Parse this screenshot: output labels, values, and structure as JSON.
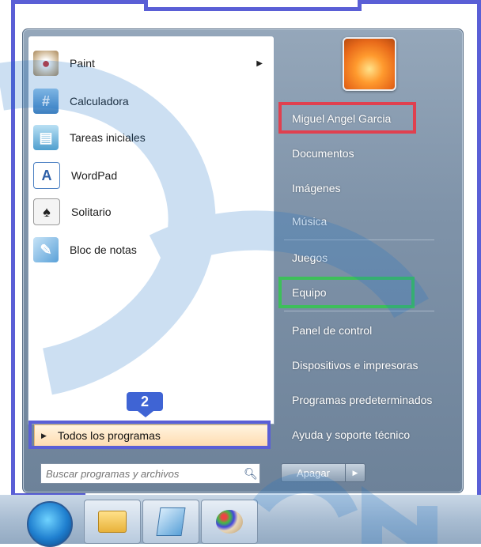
{
  "start_menu": {
    "programs": [
      {
        "label": "Paint",
        "icon": "paint-icon",
        "has_submenu": true
      },
      {
        "label": "Calculadora",
        "icon": "calculator-icon"
      },
      {
        "label": "Tareas iniciales",
        "icon": "getting-started-icon"
      },
      {
        "label": "WordPad",
        "icon": "wordpad-icon"
      },
      {
        "label": "Solitario",
        "icon": "solitaire-icon"
      },
      {
        "label": "Bloc de notas",
        "icon": "notepad-icon"
      }
    ],
    "all_programs_label": "Todos los programas",
    "search_placeholder": "Buscar programas y archivos",
    "user_name": "Miguel Angel Garcia",
    "right_items": [
      "Documentos",
      "Imágenes",
      "Música",
      "Juegos",
      "Equipo",
      "Panel de control",
      "Dispositivos e impresoras",
      "Programas predeterminados",
      "Ayuda y soporte técnico"
    ],
    "shutdown_label": "Apagar"
  },
  "annotations": {
    "step_badge": "2",
    "colors": {
      "blue_highlight": "#5a5fd6",
      "red_highlight": "#e0404f",
      "green_highlight": "#3dbf5a"
    }
  },
  "taskbar": {
    "icons": [
      "start-orb-icon",
      "explorer-icon",
      "notepad-icon",
      "paint-icon"
    ]
  }
}
